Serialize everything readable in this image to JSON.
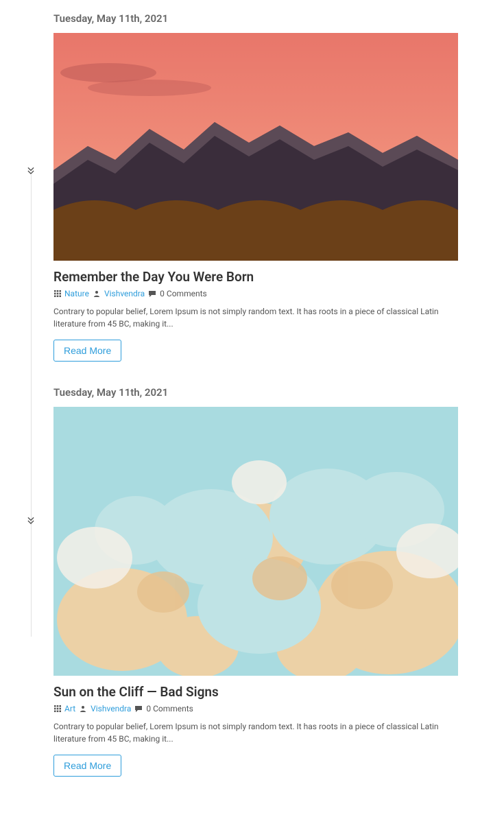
{
  "posts": [
    {
      "date": "Tuesday, May 11th, 2021",
      "title": "Remember the Day You Were Born",
      "category": "Nature",
      "author": "Vishvendra",
      "comments": "0 Comments",
      "excerpt": "Contrary to popular belief, Lorem Ipsum is not simply random text. It has roots in a piece of classical Latin literature from 45 BC, making it...",
      "readmore": "Read More"
    },
    {
      "date": "Tuesday, May 11th, 2021",
      "title": "Sun on the Cliff — Bad Signs",
      "category": "Art",
      "author": "Vishvendra",
      "comments": "0 Comments",
      "excerpt": "Contrary to popular belief, Lorem Ipsum is not simply random text. It has roots in a piece of classical Latin literature from 45 BC, making it...",
      "readmore": "Read More"
    }
  ]
}
